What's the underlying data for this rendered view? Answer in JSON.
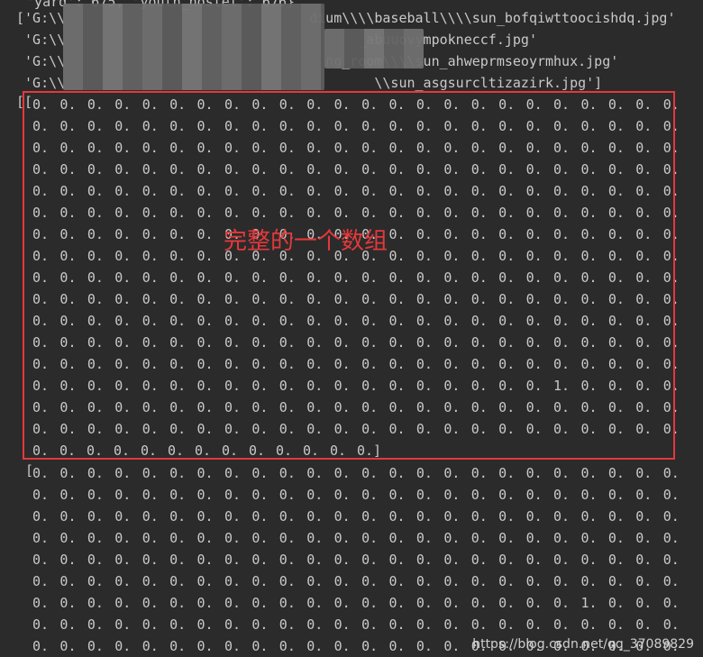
{
  "console": {
    "top_line": " 'yard': 675, 'youth_hostel': 676}",
    "paths": [
      "['G:\\\\                              dium\\\\\\\\baseball\\\\\\\\sun_bofqiwttoocishdq.jpg'",
      " 'G:\\\\                                    _abuuovympokneccf.jpg'",
      " 'G:\\\\                                ng_room\\\\\\\\sun_ahweprmseoyrmhux.jpg'",
      " 'G:\\\\                                      \\\\sun_asgsurcltizazirk.jpg']"
    ],
    "array_open": "[[",
    "second_array_open": "[",
    "cell_value": "0.",
    "one_value": "1."
  },
  "annotation": {
    "label": "完整的一个数组",
    "color": "#e5383b"
  },
  "watermark": "https://blog.csdn.net/qq_37089829"
}
